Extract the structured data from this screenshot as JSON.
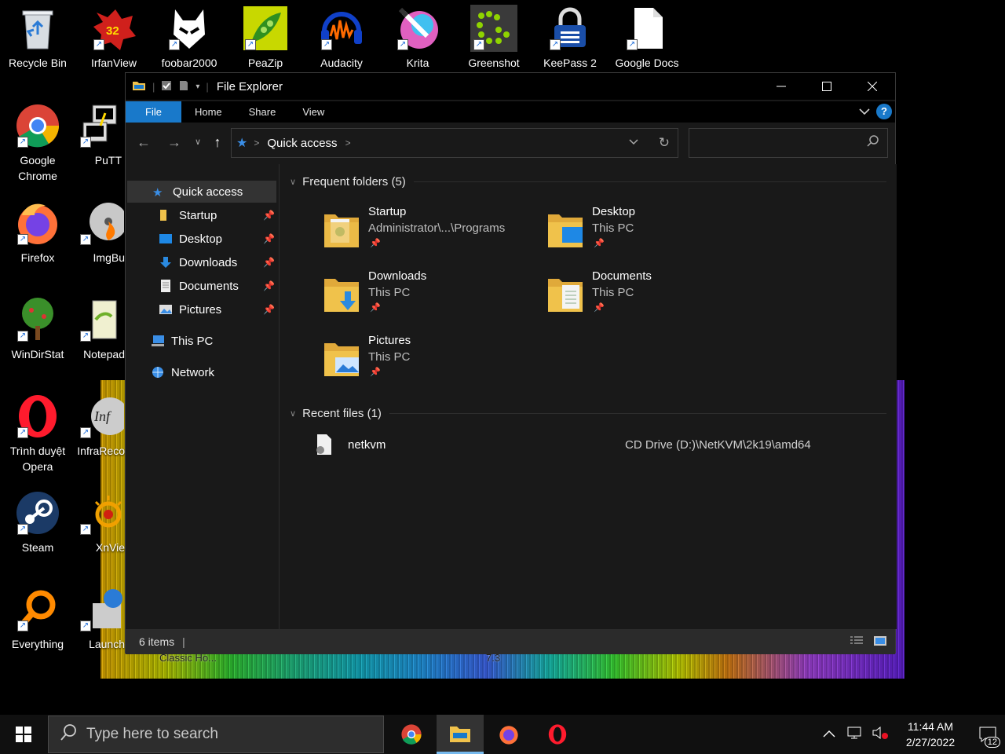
{
  "desktop": {
    "icons": [
      {
        "label": "Recycle Bin"
      },
      {
        "label": "IrfanView"
      },
      {
        "label": "foobar2000"
      },
      {
        "label": "PeaZip"
      },
      {
        "label": "Audacity"
      },
      {
        "label": "Krita"
      },
      {
        "label": "Greenshot"
      },
      {
        "label": "KeePass 2"
      },
      {
        "label": "Google Docs"
      },
      {
        "label": "Google Chrome"
      },
      {
        "label": "PuTT"
      },
      {
        "label": "Firefox"
      },
      {
        "label": "ImgBu"
      },
      {
        "label": "WinDirStat"
      },
      {
        "label": "Notepad"
      },
      {
        "label": "Trình duyệt Opera"
      },
      {
        "label": "InfraReco"
      },
      {
        "label": "Steam"
      },
      {
        "label": "XnVie"
      },
      {
        "label": "Everything"
      },
      {
        "label": "Launch"
      }
    ],
    "irfan_badge": "32",
    "wallpaper_labels": {
      "left": "Classic Ho...",
      "center": "7.3"
    }
  },
  "explorer": {
    "title": "File Explorer",
    "ribbon_tabs": [
      "File",
      "Home",
      "Share",
      "View"
    ],
    "help_label": "?",
    "address": {
      "location": "Quick access",
      "separator": ">"
    },
    "search_placeholder": "",
    "sidebar": {
      "quick_access": "Quick access",
      "pinned": [
        "Startup",
        "Desktop",
        "Downloads",
        "Documents",
        "Pictures"
      ],
      "this_pc": "This PC",
      "network": "Network"
    },
    "frequent_header": "Frequent folders (5)",
    "frequent": [
      {
        "name": "Startup",
        "sub": "Administrator\\...\\Programs"
      },
      {
        "name": "Desktop",
        "sub": "This PC"
      },
      {
        "name": "Downloads",
        "sub": "This PC"
      },
      {
        "name": "Documents",
        "sub": "This PC"
      },
      {
        "name": "Pictures",
        "sub": "This PC"
      }
    ],
    "recent_header": "Recent files (1)",
    "recent": [
      {
        "name": "netkvm",
        "path": "CD Drive (D:)\\NetKVM\\2k19\\amd64"
      }
    ],
    "status": "6 items"
  },
  "taskbar": {
    "search_placeholder": "Type here to search",
    "time": "11:44 AM",
    "date": "2/27/2022",
    "notifications": "12"
  },
  "colors": {
    "accent": "#1979ca",
    "folder": "#f0c24b"
  }
}
